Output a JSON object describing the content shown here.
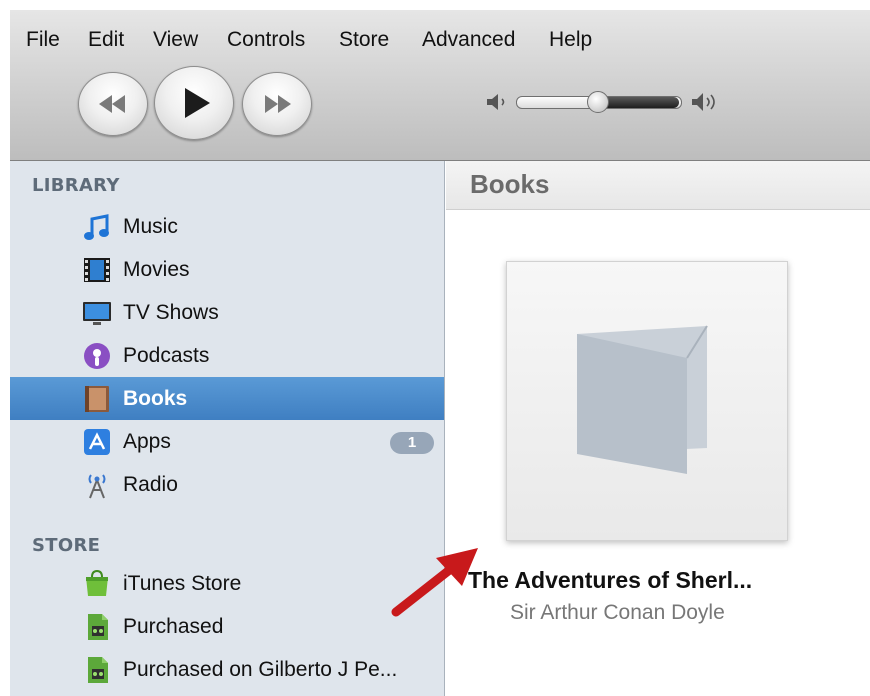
{
  "menubar": {
    "items": [
      "File",
      "Edit",
      "View",
      "Controls",
      "Store",
      "Advanced",
      "Help"
    ]
  },
  "player": {
    "controls": [
      "rewind-icon",
      "play-icon",
      "fast-forward-icon"
    ],
    "volume_level": 0.5
  },
  "sidebar": {
    "library_header": "LIBRARY",
    "library_items": [
      {
        "label": "Music",
        "icon": "music-icon"
      },
      {
        "label": "Movies",
        "icon": "movies-icon"
      },
      {
        "label": "TV Shows",
        "icon": "tv-icon"
      },
      {
        "label": "Podcasts",
        "icon": "podcast-icon"
      },
      {
        "label": "Books",
        "icon": "book-icon",
        "selected": true
      },
      {
        "label": "Apps",
        "icon": "apps-icon",
        "badge": "1"
      },
      {
        "label": "Radio",
        "icon": "radio-icon"
      }
    ],
    "store_header": "STORE",
    "store_items": [
      {
        "label": "iTunes Store",
        "icon": "itunes-store-icon"
      },
      {
        "label": "Purchased",
        "icon": "purchased-icon"
      },
      {
        "label": "Purchased on Gilberto J Pe...",
        "icon": "purchased-icon"
      }
    ]
  },
  "main": {
    "title": "Books",
    "book": {
      "title": "The Adventures of Sherl...",
      "author": "Sir Arthur Conan Doyle"
    }
  },
  "colors": {
    "selection": "#3f7fc2",
    "sidebar_bg": "#dfe5ec",
    "annotation_arrow": "#c8191b"
  }
}
